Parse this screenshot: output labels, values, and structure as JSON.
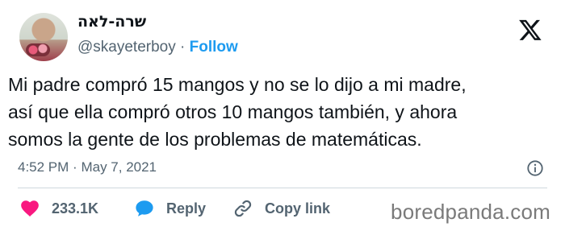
{
  "author": {
    "display_name": "שרה-לאה",
    "handle": "@skayeterboy",
    "separator": "·",
    "follow_label": "Follow"
  },
  "tweet": {
    "line1": "Mi padre compró 15 mangos y no se lo dijo a mi madre,",
    "line2": "así que ella compró otros 10 mangos también, y ahora",
    "line3": "somos la gente de los problemas de matemáticas."
  },
  "meta": {
    "time": "4:52 PM",
    "separator": "·",
    "date": "May 7, 2021"
  },
  "actions": {
    "likes_count": "233.1K",
    "reply_label": "Reply",
    "copy_link_label": "Copy link"
  },
  "watermark": "boredpanda.com",
  "colors": {
    "accent": "#1d9bf0",
    "heart": "#f91880",
    "muted": "#536471",
    "text": "#0f1419"
  },
  "icons": [
    "x-logo-icon",
    "info-icon",
    "heart-icon",
    "reply-bubble-icon",
    "link-icon"
  ]
}
